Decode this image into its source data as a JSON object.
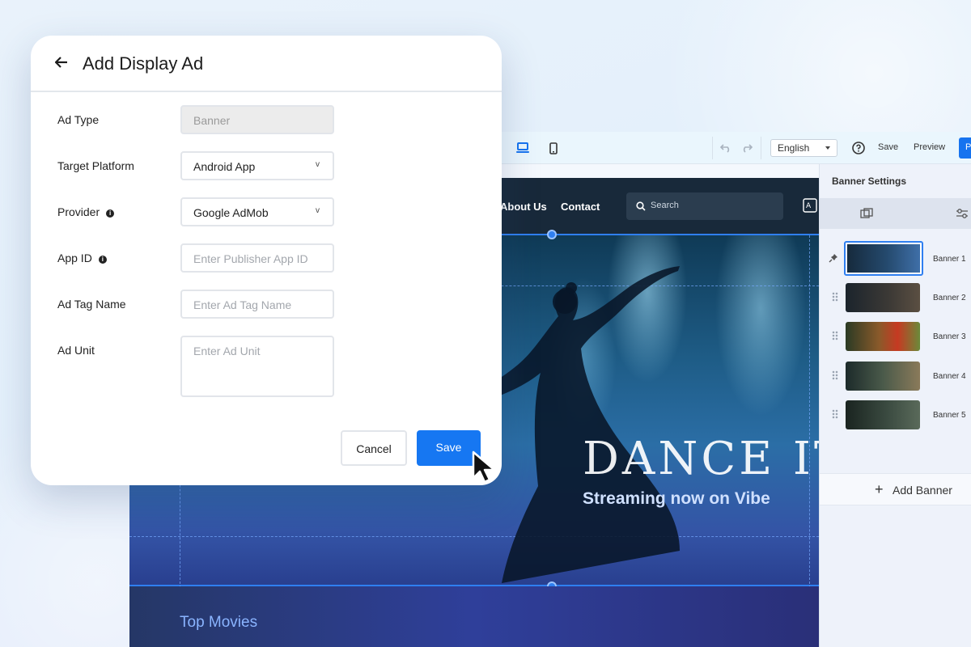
{
  "modal": {
    "title": "Add Display Ad",
    "fields": {
      "ad_type": {
        "label": "Ad Type",
        "value": "Banner"
      },
      "target_platform": {
        "label": "Target Platform",
        "value": "Android App"
      },
      "provider": {
        "label": "Provider",
        "value": "Google AdMob"
      },
      "app_id": {
        "label": "App ID",
        "placeholder": "Enter Publisher App ID"
      },
      "ad_tag_name": {
        "label": "Ad Tag Name",
        "placeholder": "Enter Ad Tag Name"
      },
      "ad_unit": {
        "label": "Ad Unit",
        "placeholder": "Enter Ad Unit"
      }
    },
    "cancel_label": "Cancel",
    "save_label": "Save"
  },
  "editor": {
    "toolbar": {
      "language": "English",
      "save_label": "Save",
      "preview_label": "Preview",
      "publish_label": "P"
    },
    "site_nav": {
      "links": [
        "About Us",
        "Contact"
      ],
      "search_placeholder": "Search"
    },
    "hero": {
      "title": "DANCE IT",
      "subtitle": "Streaming now on Vibe"
    },
    "section_title": "Top Movies",
    "banner_settings": {
      "title": "Banner Settings",
      "banners": [
        {
          "label": "Banner 1",
          "active": true,
          "pinned": true
        },
        {
          "label": "Banner 2",
          "active": false,
          "pinned": false
        },
        {
          "label": "Banner 3",
          "active": false,
          "pinned": false
        },
        {
          "label": "Banner 4",
          "active": false,
          "pinned": false
        },
        {
          "label": "Banner 5",
          "active": false,
          "pinned": false
        }
      ],
      "add_label": "Add Banner"
    }
  },
  "colors": {
    "primary": "#1677f2",
    "selection": "#2f7ff0",
    "nav_dark": "#18293a"
  }
}
